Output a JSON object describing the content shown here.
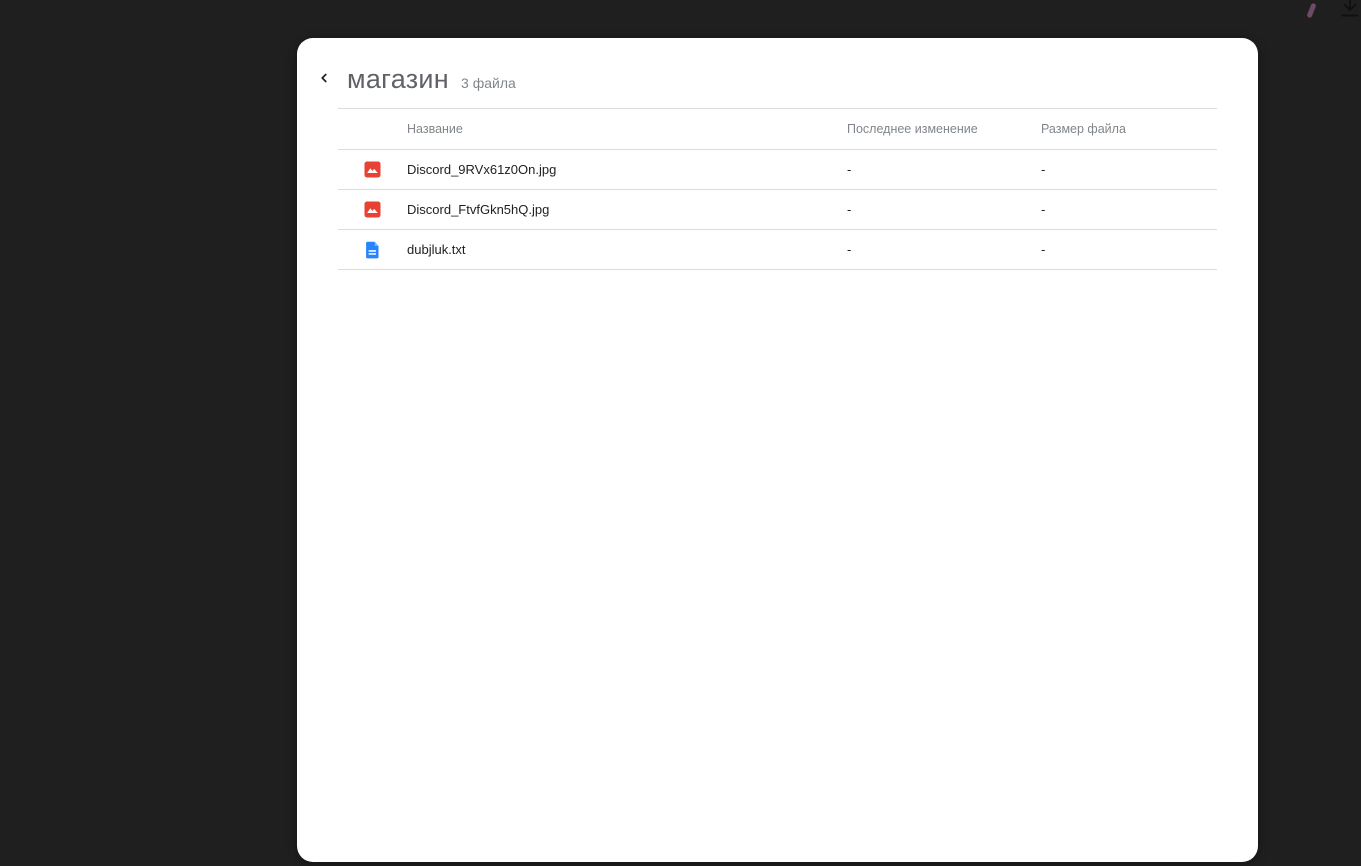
{
  "window": {
    "background": "#1f1f1f"
  },
  "topbar": {
    "icons": [
      "pen-mark",
      "download-icon"
    ]
  },
  "header": {
    "back_icon": "chevron-left-icon",
    "title": "магазин",
    "count": "3 файла"
  },
  "table": {
    "columns": [
      "Название",
      "Последнее изменение",
      "Размер файла"
    ],
    "rows": [
      {
        "icon": "image-file-icon",
        "name": "Discord_9RVx61z0On.jpg",
        "modified": "-",
        "size": "-"
      },
      {
        "icon": "image-file-icon",
        "name": "Discord_FtvfGkn5hQ.jpg",
        "modified": "-",
        "size": "-"
      },
      {
        "icon": "text-file-icon",
        "name": "dubjluk.txt",
        "modified": "-",
        "size": "-"
      }
    ]
  },
  "colors": {
    "background": "#1f1f1f",
    "panel": "#ffffff",
    "divider": "#dadce0",
    "title_text": "#5f6368",
    "muted_text": "#80868b",
    "file_text": "#202124",
    "image_icon_red": "#e94235",
    "text_icon_blue": "#2684fc",
    "pen_mark": "#6d4a66",
    "download_icon": "#111111"
  }
}
